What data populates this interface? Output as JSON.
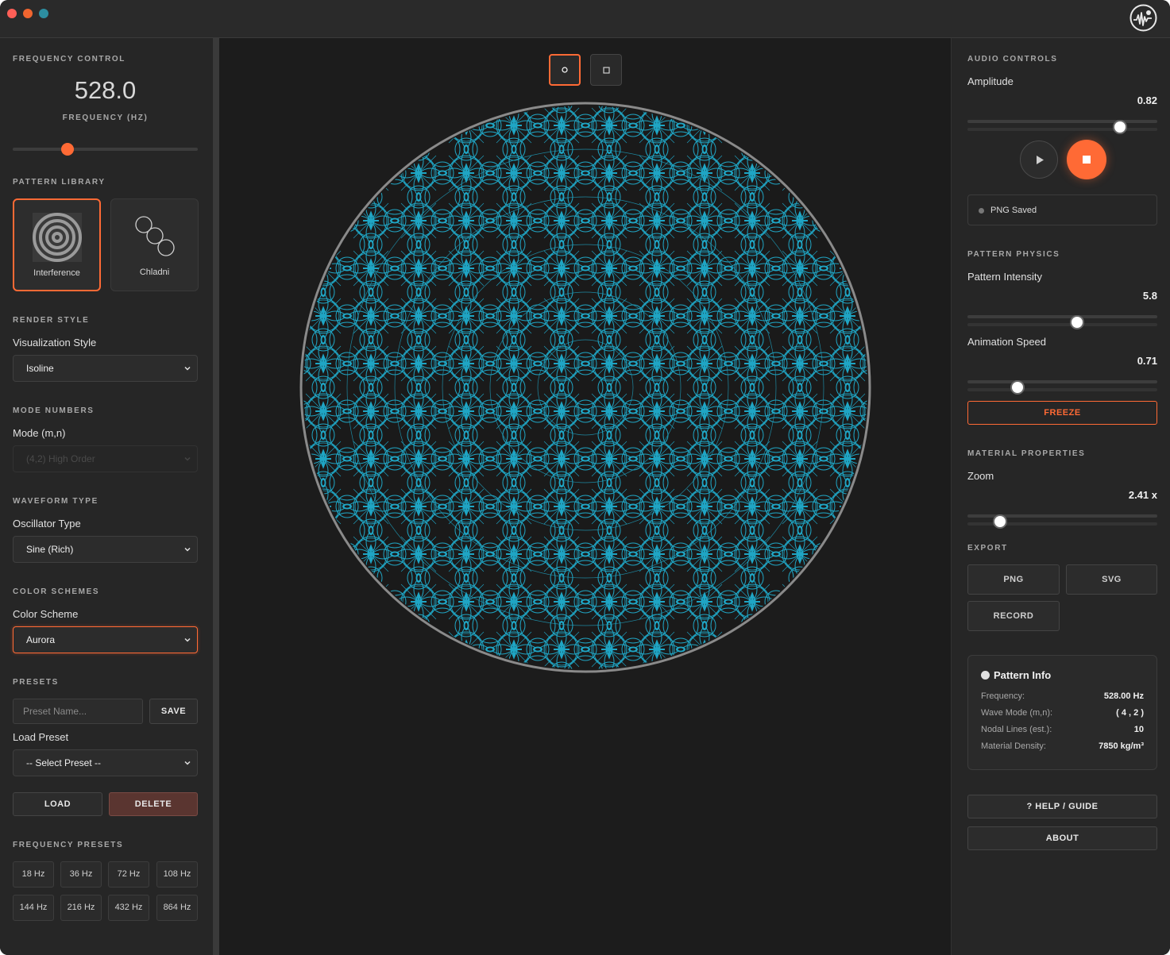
{
  "window": {
    "traffic_lights": [
      "close",
      "minimize",
      "zoom"
    ],
    "logo_icon": "waveform-logo-icon"
  },
  "left": {
    "frequency": {
      "section": "FREQUENCY CONTROL",
      "value": "528.0",
      "unit": "FREQUENCY (HZ)",
      "slider_fraction": 0.28
    },
    "pattern_library": {
      "section": "PATTERN LIBRARY",
      "items": [
        {
          "label": "Interference",
          "icon": "concentric-rings-icon",
          "active": true
        },
        {
          "label": "Chladni",
          "icon": "overlapping-circles-icon",
          "active": false
        }
      ]
    },
    "render_style": {
      "section": "RENDER STYLE",
      "label": "Visualization Style",
      "value": "Isoline"
    },
    "mode_numbers": {
      "section": "MODE NUMBERS",
      "label": "Mode (m,n)",
      "value": "(4,2) High Order"
    },
    "waveform": {
      "section": "WAVEFORM TYPE",
      "label": "Oscillator Type",
      "value": "Sine (Rich)"
    },
    "color_schemes": {
      "section": "COLOR SCHEMES",
      "label": "Color Scheme",
      "value": "Aurora"
    },
    "presets": {
      "section": "PRESETS",
      "name_placeholder": "Preset Name...",
      "save_label": "SAVE",
      "load_label_text": "Load Preset",
      "select_value": "-- Select Preset --",
      "load_button": "LOAD",
      "delete_button": "DELETE"
    },
    "freq_presets": {
      "section": "FREQUENCY PRESETS",
      "items": [
        "18 Hz",
        "36 Hz",
        "72 Hz",
        "108 Hz",
        "144 Hz",
        "216 Hz",
        "432 Hz",
        "864 Hz"
      ]
    }
  },
  "center": {
    "shape_buttons": [
      {
        "icon": "circle-icon",
        "active": true
      },
      {
        "icon": "square-icon",
        "active": false
      }
    ],
    "pattern_color": "#1fa5c4"
  },
  "right": {
    "audio": {
      "section": "AUDIO CONTROLS",
      "amplitude_label": "Amplitude",
      "amplitude_value": "0.82",
      "amplitude_fraction": 0.82
    },
    "status": {
      "text": "PNG Saved"
    },
    "physics": {
      "section": "PATTERN PHYSICS",
      "intensity_label": "Pattern Intensity",
      "intensity_value": "5.8",
      "intensity_fraction": 0.58,
      "speed_label": "Animation Speed",
      "speed_value": "0.71",
      "speed_fraction": 0.25,
      "freeze_label": "FREEZE"
    },
    "material": {
      "section": "MATERIAL PROPERTIES",
      "zoom_label": "Zoom",
      "zoom_value": "2.41 x",
      "zoom_fraction": 0.15
    },
    "export": {
      "section": "EXPORT",
      "png": "PNG",
      "svg": "SVG",
      "record": "RECORD"
    },
    "info": {
      "title": "Pattern Info",
      "rows": [
        {
          "key": "Frequency:",
          "value": "528.00 Hz"
        },
        {
          "key": "Wave Mode (m,n):",
          "value": "( 4 , 2 )"
        },
        {
          "key": "Nodal Lines (est.):",
          "value": "10"
        },
        {
          "key": "Material Density:",
          "value": "7850 kg/m³"
        }
      ]
    },
    "help_label": "? HELP / GUIDE",
    "about_label": "ABOUT"
  },
  "colors": {
    "accent": "#ff6a35",
    "cyan": "#1fa5c4"
  }
}
